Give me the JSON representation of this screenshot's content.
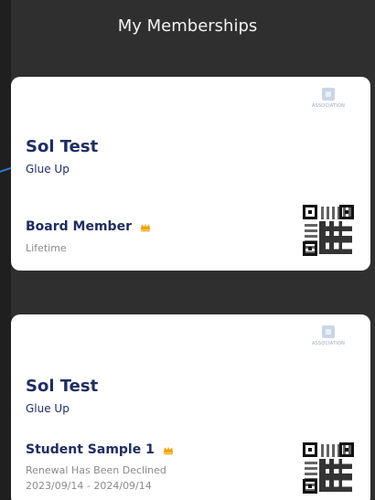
{
  "header": {
    "title": "My Memberships"
  },
  "cards": [
    {
      "logo_text": "ASSOCIATION",
      "org": "Sol Test",
      "subtitle": "Glue Up",
      "plan_name": "Board Member",
      "detail_1": "Lifetime"
    },
    {
      "logo_text": "ASSOCIATION",
      "org": "Sol Test",
      "subtitle": "Glue Up",
      "plan_name": "Student Sample 1",
      "detail_1": "Renewal Has Been Declined",
      "detail_2": "2023/09/14 - 2024/09/14"
    }
  ],
  "colors": {
    "background": "#2f2f2f",
    "card": "#ffffff",
    "primary_text": "#1f2d62",
    "muted_text": "#8b8b8b",
    "crown": "#f2a400",
    "accent_line": "#2d7bd6"
  },
  "icons": {
    "crown": "crown-icon",
    "logo": "association-logo",
    "qr": "qr-code"
  }
}
